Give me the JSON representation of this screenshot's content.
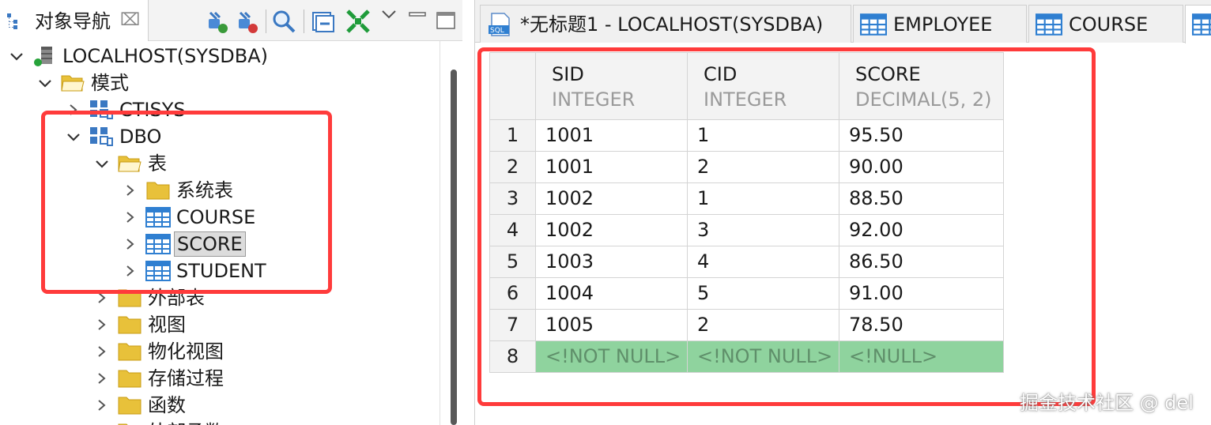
{
  "navigator": {
    "tab_label": "对象导航",
    "tab_close": "⌧",
    "toolbar_icons": [
      "connect-icon",
      "disconnect-icon",
      "search-icon",
      "collapse-all-icon",
      "link-editor-icon",
      "view-menu-icon",
      "minimize-icon",
      "maximize-icon"
    ],
    "tree": [
      {
        "label": "LOCALHOST(SYSDBA)",
        "icon": "server-icon",
        "expanded": true
      },
      {
        "label": "模式",
        "icon": "folder-open-icon",
        "expanded": true
      },
      {
        "label": "CTISYS",
        "icon": "schema-icon",
        "expanded": false
      },
      {
        "label": "DBO",
        "icon": "schema-icon",
        "expanded": true
      },
      {
        "label": "表",
        "icon": "folder-open-icon",
        "expanded": true
      },
      {
        "label": "系统表",
        "icon": "folder-icon",
        "expanded": false
      },
      {
        "label": "COURSE",
        "icon": "table-icon",
        "expanded": false
      },
      {
        "label": "SCORE",
        "icon": "table-icon",
        "expanded": false,
        "selected": true
      },
      {
        "label": "STUDENT",
        "icon": "table-icon",
        "expanded": false
      },
      {
        "label": "外部表",
        "icon": "folder-icon",
        "expanded": false
      },
      {
        "label": "视图",
        "icon": "folder-icon",
        "expanded": false
      },
      {
        "label": "物化视图",
        "icon": "folder-icon",
        "expanded": false
      },
      {
        "label": "存储过程",
        "icon": "folder-icon",
        "expanded": false
      },
      {
        "label": "函数",
        "icon": "folder-icon",
        "expanded": false
      },
      {
        "label": "外部函数",
        "icon": "folder-icon",
        "expanded": false
      }
    ]
  },
  "editor_tabs": [
    {
      "label": "*无标题1 - LOCALHOST(SYSDBA)",
      "icon": "sql-file-icon"
    },
    {
      "label": "EMPLOYEE",
      "icon": "table-icon"
    },
    {
      "label": "COURSE",
      "icon": "table-icon"
    },
    {
      "label": "",
      "icon": "table-icon",
      "active": true
    }
  ],
  "grid": {
    "columns": [
      {
        "name": "SID",
        "type": "INTEGER"
      },
      {
        "name": "CID",
        "type": "INTEGER"
      },
      {
        "name": "SCORE",
        "type": "DECIMAL(5, 2)"
      }
    ],
    "rows": [
      {
        "num": "1",
        "cells": [
          "1001",
          "1",
          "95.50"
        ]
      },
      {
        "num": "2",
        "cells": [
          "1001",
          "2",
          "90.00"
        ]
      },
      {
        "num": "3",
        "cells": [
          "1002",
          "1",
          "88.50"
        ]
      },
      {
        "num": "4",
        "cells": [
          "1002",
          "3",
          "92.00"
        ]
      },
      {
        "num": "5",
        "cells": [
          "1003",
          "4",
          "86.50"
        ]
      },
      {
        "num": "6",
        "cells": [
          "1004",
          "5",
          "91.00"
        ]
      },
      {
        "num": "7",
        "cells": [
          "1005",
          "2",
          "78.50"
        ]
      }
    ],
    "new_row": {
      "num": "8",
      "cells": [
        "<!NOT NULL>",
        "<!NOT NULL>",
        "<!NULL>"
      ]
    }
  },
  "colors": {
    "highlight": "#ff3b3b",
    "new_row": "#8fd39e",
    "table_icon": "#2f7fd1",
    "folder": "#e8c13a"
  },
  "watermark": "掘金技术社区 @ del"
}
